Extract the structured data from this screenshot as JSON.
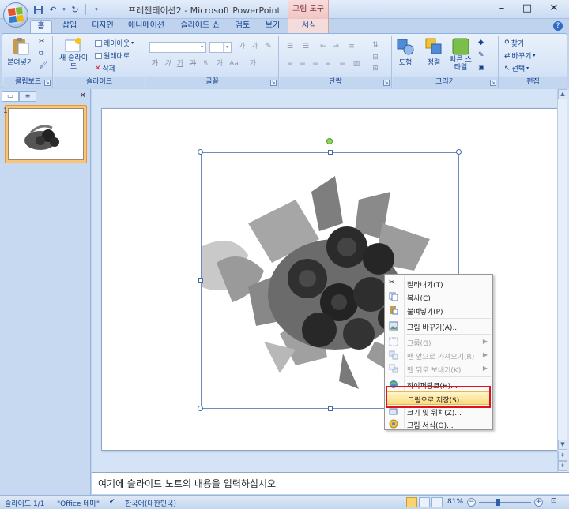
{
  "titlebar": {
    "title": "프레젠테이션2 - Microsoft PowerPoint",
    "context_title": "그림 도구",
    "minimize": "–",
    "maximize": "□",
    "close": "✕"
  },
  "tabs": [
    {
      "label": "홈",
      "active": true
    },
    {
      "label": "삽입"
    },
    {
      "label": "디자인"
    },
    {
      "label": "애니메이션"
    },
    {
      "label": "슬라이드 쇼"
    },
    {
      "label": "검토"
    },
    {
      "label": "보기"
    },
    {
      "label": "서식",
      "contextual": true
    }
  ],
  "ribbon": {
    "clipboard": {
      "paste": "붙여넣기",
      "label": "클립보드"
    },
    "slides": {
      "new_slide": "새 슬라이드",
      "layout": "레이아웃",
      "reset": "원래대로",
      "delete": "삭제",
      "label": "슬라이드"
    },
    "font": {
      "label": "글꼴"
    },
    "paragraph": {
      "label": "단락"
    },
    "drawing": {
      "shape": "도형",
      "arrange": "정렬",
      "quick_styles": "빠른 스타일",
      "label": "그리기"
    },
    "editing": {
      "find": "찾기",
      "replace": "바꾸기",
      "select": "선택",
      "label": "편집"
    }
  },
  "slide_pane": {
    "thumb_number": "1"
  },
  "notes_placeholder": "여기에 슬라이드 노트의 내용을 입력하십시오",
  "status": {
    "slide": "슬라이드 1/1",
    "theme": "\"Office 테마\"",
    "language": "한국어(대한민국)",
    "zoom": "81%"
  },
  "context_menu": {
    "items": [
      {
        "label": "잘라내기(T)",
        "icon": "scissors-icon"
      },
      {
        "label": "복사(C)",
        "icon": "copy-icon"
      },
      {
        "label": "붙여넣기(P)",
        "icon": "paste-icon"
      },
      {
        "label": "그림 바꾸기(A)...",
        "icon": "change-picture-icon"
      },
      {
        "label": "그룹(G)",
        "icon": "group-icon",
        "disabled": true,
        "submenu": true
      },
      {
        "label": "맨 앞으로 가져오기(R)",
        "icon": "bring-front-icon",
        "disabled": true,
        "submenu": true
      },
      {
        "label": "맨 뒤로 보내기(K)",
        "icon": "send-back-icon",
        "disabled": true,
        "submenu": true
      },
      {
        "label": "하이퍼링크(H)...",
        "icon": "hyperlink-icon"
      },
      {
        "label": "그림으로 저장(S)...",
        "icon": "none",
        "highlighted": true
      },
      {
        "label": "크기 및 위치(Z)...",
        "icon": "size-icon"
      },
      {
        "label": "그림 서식(O)...",
        "icon": "format-picture-icon"
      }
    ]
  },
  "colors": {
    "accent": "#15428b",
    "highlight": "#fddb7b",
    "callout": "#e1101e"
  }
}
